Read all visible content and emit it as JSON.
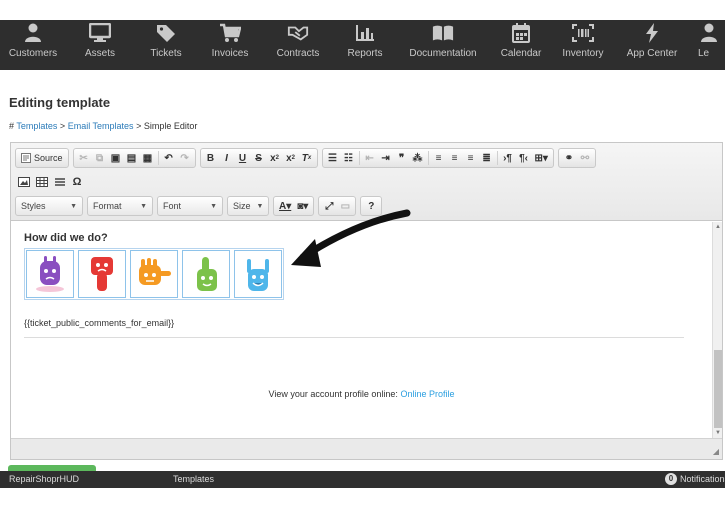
{
  "nav": {
    "items": [
      {
        "label": "Customers",
        "icon": "person-icon"
      },
      {
        "label": "Assets",
        "icon": "monitor-icon"
      },
      {
        "label": "Tickets",
        "icon": "tag-icon"
      },
      {
        "label": "Invoices",
        "icon": "cart-icon"
      },
      {
        "label": "Contracts",
        "icon": "handshake-icon"
      },
      {
        "label": "Reports",
        "icon": "bar-chart-icon"
      },
      {
        "label": "Documentation",
        "icon": "book-icon"
      },
      {
        "label": "Calendar",
        "icon": "calendar-icon"
      },
      {
        "label": "Inventory",
        "icon": "barcode-icon"
      },
      {
        "label": "App Center",
        "icon": "bolt-icon"
      },
      {
        "label": "Le",
        "icon": "person-icon"
      }
    ]
  },
  "header": {
    "title": "Editing template",
    "breadcrumb": {
      "hash": "#",
      "item1": "Templates",
      "sep1": ">",
      "item2": "Email Templates",
      "sep2": ">",
      "current": "Simple Editor"
    }
  },
  "toolbar": {
    "source_label": "Source",
    "combos": {
      "styles": "Styles",
      "format": "Format",
      "font": "Font",
      "size": "Size"
    },
    "help_label": "?"
  },
  "content": {
    "heading": "How did we do?",
    "faces": [
      {
        "name": "face-rating-1",
        "color": "#8a4fc0"
      },
      {
        "name": "face-rating-2",
        "color": "#e53935"
      },
      {
        "name": "face-rating-3",
        "color": "#f59a23"
      },
      {
        "name": "face-rating-4",
        "color": "#7cc24a"
      },
      {
        "name": "face-rating-5",
        "color": "#4fb6ea"
      }
    ],
    "merge_field": "{{ticket_public_comments_for_email}}",
    "profile_text": "View your account profile online:",
    "profile_link": "Online Profile"
  },
  "bottom": {
    "app_name": "RepairShoprHUD",
    "templates_label": "Templates",
    "notif_count": "0",
    "notif_label": "Notifications"
  },
  "colors": {
    "nav_bg": "#2e2e2e",
    "link": "#2b7bb9",
    "profile_link": "#2b9fe0",
    "green": "#5cb85c"
  }
}
